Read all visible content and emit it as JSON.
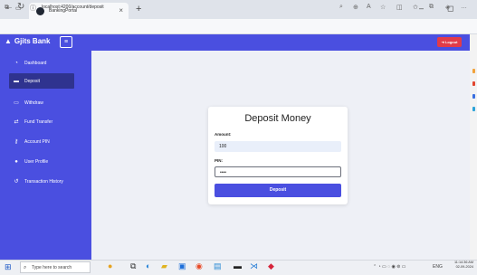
{
  "browser": {
    "tab_title": "BankingPortal",
    "url": "localhost:4200/account/deposit",
    "new_tab_symbol": "+",
    "close_tab_symbol": "×"
  },
  "app": {
    "brand": "Gjits Bank",
    "menu_icon": "≡",
    "logout_label": "Logout",
    "sidebar": [
      {
        "label": "Dashboard",
        "icon": "dashboard-icon",
        "glyph": "◔"
      },
      {
        "label": "Deposit",
        "icon": "wallet-icon",
        "glyph": "▬"
      },
      {
        "label": "Withdraw",
        "icon": "cash-icon",
        "glyph": "▭"
      },
      {
        "label": "Fund Transfer",
        "icon": "transfer-icon",
        "glyph": "⇄"
      },
      {
        "label": "Account PIN",
        "icon": "key-icon",
        "glyph": "⚷"
      },
      {
        "label": "User Profile",
        "icon": "user-icon",
        "glyph": "●"
      },
      {
        "label": "Transaction History",
        "icon": "history-icon",
        "glyph": "↺"
      }
    ],
    "active_index": 1,
    "colors": {
      "primary": "#4a4fe0",
      "active": "#2f338f",
      "logout": "#e23b49"
    }
  },
  "form": {
    "title": "Deposit Money",
    "amount_label": "Amount:",
    "amount_value": "100",
    "pin_label": "PIN:",
    "pin_value": "••••",
    "submit_label": "Deposit"
  },
  "taskbar": {
    "search_placeholder": "Type here to search",
    "tray_lang": "ENG",
    "time": "11:14:36 AM",
    "date": "02-09-2024"
  }
}
